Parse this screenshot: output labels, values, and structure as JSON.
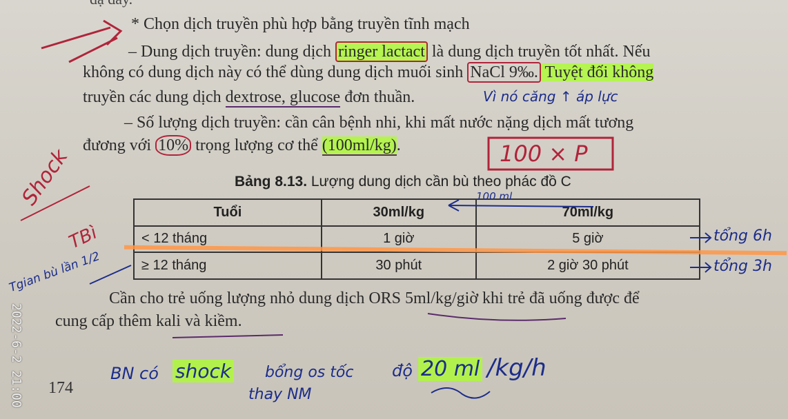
{
  "document": {
    "top_cut": "dạ dày.",
    "line1": "* Chọn dịch truyền phù hợp bằng truyền tĩnh mạch",
    "line2_a": "– Dung dịch truyền: dung dịch ",
    "line2_hl": "ringer lactact",
    "line2_b": " là dung dịch truyền tốt nhất. Nếu",
    "line3_a": "không có dung dịch này có thể dùng dung dịch muối sinh ",
    "line3_box": "NaCl 9‰.",
    "line3_b": " Tuyệt đối không",
    "line4_a": "truyền các dung dịch ",
    "line4_u": "dextrose, glucose",
    "line4_b": " đơn thuần.",
    "line5": "– Số lượng dịch truyền: cần cân bệnh nhi, khi mất nước nặng dịch mất tương",
    "line6_a": "đương với ",
    "line6_circle": "10%",
    "line6_b": " trọng lượng cơ thể ",
    "line6_hl": "(100ml/kg)",
    "line6_c": ".",
    "caption_bold": "Bảng 8.13.",
    "caption_rest": " Lượng dung dịch cần bù theo phác đồ C",
    "line7": "Cần cho trẻ uống lượng nhỏ dung dịch ORS 5ml/kg/giờ khi trẻ đã uống được để",
    "line8": "cung cấp thêm kali và kiềm.",
    "page_number": "174"
  },
  "table": {
    "headers": [
      "Tuổi",
      "30ml/kg",
      "70ml/kg"
    ],
    "rows": [
      [
        "< 12  tháng",
        "1 giờ",
        "5 giờ"
      ],
      [
        "≥ 12 tháng",
        "30 phút",
        "2 giờ 30 phút"
      ]
    ]
  },
  "annotations": {
    "note_viral": "Vì nó căng ↑ áp lực",
    "box_formula": "100 × P",
    "shock": "Shock",
    "time_vertical": "TBì",
    "time_note": "Tgian bù lần 1/2",
    "arrow_100ml": "100 ml",
    "right_row1": "tổng 6h",
    "right_row2": "tổng 3h",
    "bottom_a": "BN có",
    "bottom_hl1": "shock",
    "bottom_b": "bổng os tốc",
    "bottom_c": "độ",
    "bottom_hl2": "20 ml",
    "bottom_d": "/kg/h",
    "bottom_e": "thay NM",
    "date_stamp": "2022-6-2 21:00"
  },
  "colors": {
    "highlight": "#aaff28",
    "red_ink": "#b0243a",
    "blue_ink": "#1c2d8a",
    "orange_ink": "#ff9646"
  }
}
